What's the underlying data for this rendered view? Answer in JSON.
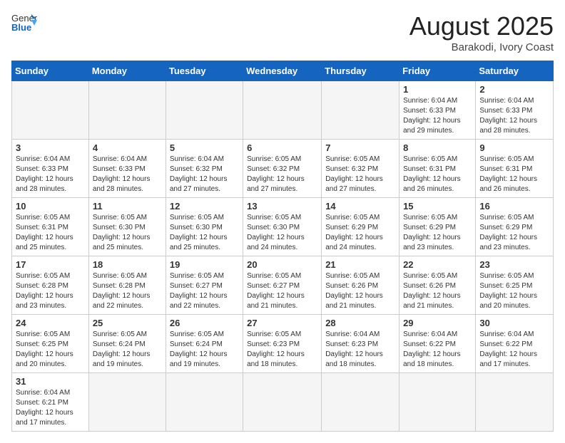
{
  "header": {
    "logo_general": "General",
    "logo_blue": "Blue",
    "month_title": "August 2025",
    "location": "Barakodi, Ivory Coast"
  },
  "days_of_week": [
    "Sunday",
    "Monday",
    "Tuesday",
    "Wednesday",
    "Thursday",
    "Friday",
    "Saturday"
  ],
  "weeks": [
    [
      {
        "day": "",
        "info": ""
      },
      {
        "day": "",
        "info": ""
      },
      {
        "day": "",
        "info": ""
      },
      {
        "day": "",
        "info": ""
      },
      {
        "day": "",
        "info": ""
      },
      {
        "day": "1",
        "info": "Sunrise: 6:04 AM\nSunset: 6:33 PM\nDaylight: 12 hours and 29 minutes."
      },
      {
        "day": "2",
        "info": "Sunrise: 6:04 AM\nSunset: 6:33 PM\nDaylight: 12 hours and 28 minutes."
      }
    ],
    [
      {
        "day": "3",
        "info": "Sunrise: 6:04 AM\nSunset: 6:33 PM\nDaylight: 12 hours and 28 minutes."
      },
      {
        "day": "4",
        "info": "Sunrise: 6:04 AM\nSunset: 6:33 PM\nDaylight: 12 hours and 28 minutes."
      },
      {
        "day": "5",
        "info": "Sunrise: 6:04 AM\nSunset: 6:32 PM\nDaylight: 12 hours and 27 minutes."
      },
      {
        "day": "6",
        "info": "Sunrise: 6:05 AM\nSunset: 6:32 PM\nDaylight: 12 hours and 27 minutes."
      },
      {
        "day": "7",
        "info": "Sunrise: 6:05 AM\nSunset: 6:32 PM\nDaylight: 12 hours and 27 minutes."
      },
      {
        "day": "8",
        "info": "Sunrise: 6:05 AM\nSunset: 6:31 PM\nDaylight: 12 hours and 26 minutes."
      },
      {
        "day": "9",
        "info": "Sunrise: 6:05 AM\nSunset: 6:31 PM\nDaylight: 12 hours and 26 minutes."
      }
    ],
    [
      {
        "day": "10",
        "info": "Sunrise: 6:05 AM\nSunset: 6:31 PM\nDaylight: 12 hours and 25 minutes."
      },
      {
        "day": "11",
        "info": "Sunrise: 6:05 AM\nSunset: 6:30 PM\nDaylight: 12 hours and 25 minutes."
      },
      {
        "day": "12",
        "info": "Sunrise: 6:05 AM\nSunset: 6:30 PM\nDaylight: 12 hours and 25 minutes."
      },
      {
        "day": "13",
        "info": "Sunrise: 6:05 AM\nSunset: 6:30 PM\nDaylight: 12 hours and 24 minutes."
      },
      {
        "day": "14",
        "info": "Sunrise: 6:05 AM\nSunset: 6:29 PM\nDaylight: 12 hours and 24 minutes."
      },
      {
        "day": "15",
        "info": "Sunrise: 6:05 AM\nSunset: 6:29 PM\nDaylight: 12 hours and 23 minutes."
      },
      {
        "day": "16",
        "info": "Sunrise: 6:05 AM\nSunset: 6:29 PM\nDaylight: 12 hours and 23 minutes."
      }
    ],
    [
      {
        "day": "17",
        "info": "Sunrise: 6:05 AM\nSunset: 6:28 PM\nDaylight: 12 hours and 23 minutes."
      },
      {
        "day": "18",
        "info": "Sunrise: 6:05 AM\nSunset: 6:28 PM\nDaylight: 12 hours and 22 minutes."
      },
      {
        "day": "19",
        "info": "Sunrise: 6:05 AM\nSunset: 6:27 PM\nDaylight: 12 hours and 22 minutes."
      },
      {
        "day": "20",
        "info": "Sunrise: 6:05 AM\nSunset: 6:27 PM\nDaylight: 12 hours and 21 minutes."
      },
      {
        "day": "21",
        "info": "Sunrise: 6:05 AM\nSunset: 6:26 PM\nDaylight: 12 hours and 21 minutes."
      },
      {
        "day": "22",
        "info": "Sunrise: 6:05 AM\nSunset: 6:26 PM\nDaylight: 12 hours and 21 minutes."
      },
      {
        "day": "23",
        "info": "Sunrise: 6:05 AM\nSunset: 6:25 PM\nDaylight: 12 hours and 20 minutes."
      }
    ],
    [
      {
        "day": "24",
        "info": "Sunrise: 6:05 AM\nSunset: 6:25 PM\nDaylight: 12 hours and 20 minutes."
      },
      {
        "day": "25",
        "info": "Sunrise: 6:05 AM\nSunset: 6:24 PM\nDaylight: 12 hours and 19 minutes."
      },
      {
        "day": "26",
        "info": "Sunrise: 6:05 AM\nSunset: 6:24 PM\nDaylight: 12 hours and 19 minutes."
      },
      {
        "day": "27",
        "info": "Sunrise: 6:05 AM\nSunset: 6:23 PM\nDaylight: 12 hours and 18 minutes."
      },
      {
        "day": "28",
        "info": "Sunrise: 6:04 AM\nSunset: 6:23 PM\nDaylight: 12 hours and 18 minutes."
      },
      {
        "day": "29",
        "info": "Sunrise: 6:04 AM\nSunset: 6:22 PM\nDaylight: 12 hours and 18 minutes."
      },
      {
        "day": "30",
        "info": "Sunrise: 6:04 AM\nSunset: 6:22 PM\nDaylight: 12 hours and 17 minutes."
      }
    ],
    [
      {
        "day": "31",
        "info": "Sunrise: 6:04 AM\nSunset: 6:21 PM\nDaylight: 12 hours and 17 minutes."
      },
      {
        "day": "",
        "info": ""
      },
      {
        "day": "",
        "info": ""
      },
      {
        "day": "",
        "info": ""
      },
      {
        "day": "",
        "info": ""
      },
      {
        "day": "",
        "info": ""
      },
      {
        "day": "",
        "info": ""
      }
    ]
  ]
}
